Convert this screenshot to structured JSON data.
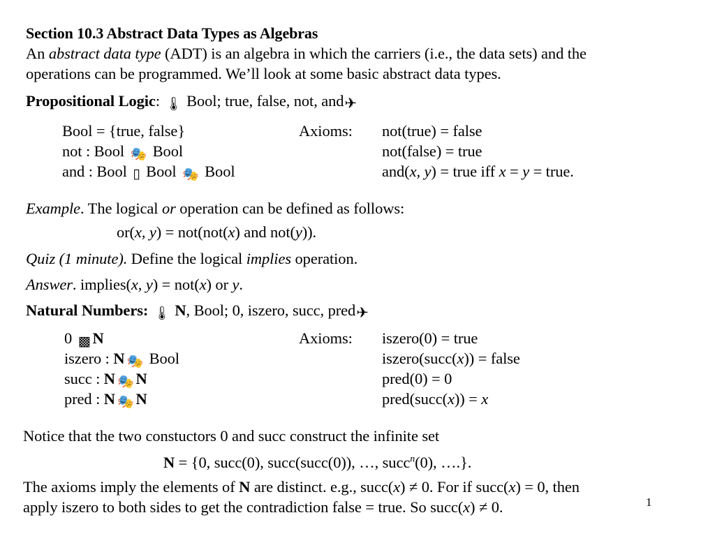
{
  "slide": {
    "page_number": "1",
    "heading": "Section 10.3 Abstract Data Types as Algebras",
    "intro": {
      "line1_a": "An ",
      "line1_i": "abstract data type",
      "line1_b": " (ADT) is an algebra in which the carriers (i.e., the data sets) and the",
      "line2": "operations can be programmed. We’ll look at some basic abstract data types."
    },
    "prop_logic": {
      "label": "Propositional Logic",
      "colon": ":",
      "open_bracket_icon": "thermometer-icon",
      "signature": " Bool; true, false, not, and",
      "close_bracket_icon": "airplane-icon",
      "defs": [
        {
          "text": "Bool = {true, false}"
        },
        {
          "pre": "not : Bool ",
          "icon": "masks-icon",
          "post": " Bool"
        },
        {
          "pre": "and : Bool ",
          "icon": "eraser-icon",
          "mid": " Bool ",
          "icon2": "masks-icon",
          "post": " Bool"
        }
      ],
      "axioms_label": "Axioms:",
      "axioms": [
        {
          "text": "not(true) = false"
        },
        {
          "text": "not(false) = true"
        },
        {
          "pre": "and(",
          "v1": "x, y",
          "post": ") = true iff ",
          "v2": "x",
          "eq": " = ",
          "v3": "y",
          "tail": " = true."
        }
      ]
    },
    "example": {
      "label": "Example",
      "lead": ". The logical ",
      "op": "or",
      "tail": " operation can be defined as follows:",
      "formula_pre": "or(",
      "formula_v": "x, y",
      "formula_mid": ") = not(not(",
      "formula_x": "x",
      "formula_mid2": ") and not(",
      "formula_y": "y",
      "formula_end": "))."
    },
    "quiz": {
      "label": "Quiz (1 minute).",
      "lead": " Define the logical ",
      "op": "implies",
      "tail": " operation."
    },
    "answer": {
      "label": "Answer",
      "lead": ". implies(",
      "v1": "x, y",
      "mid": ") = not(",
      "v2": "x",
      "mid2": ") or ",
      "v3": "y",
      "end": "."
    },
    "naturals": {
      "label": "Natural Numbers:",
      "open_bracket_icon": "thermometer-icon",
      "sig_bold": "N",
      "signature": ", Bool; 0, iszero, succ, pred",
      "close_bracket_icon": "airplane-icon",
      "defs": [
        {
          "pre": "0 ",
          "icon": "element-of-icon",
          "bold": "N"
        },
        {
          "pre": "iszero : ",
          "bold": "N",
          "icon": "masks-icon",
          "post": " Bool"
        },
        {
          "pre": "succ : ",
          "bold": "N",
          "icon": "masks-icon",
          "post_bold": "N"
        },
        {
          "pre": "pred : ",
          "bold": "N",
          "icon": "masks-icon",
          "post_bold": "N"
        }
      ],
      "axioms_label": "Axioms:",
      "axioms": [
        {
          "text": "iszero(0) = true"
        },
        {
          "pre": "iszero(succ(",
          "v": "x",
          "post": ")) = false"
        },
        {
          "text": "pred(0) = 0"
        },
        {
          "pre": "pred(succ(",
          "v": "x",
          "post": ")) = ",
          "v2": "x"
        }
      ]
    },
    "closing": {
      "notice": "Notice that the two constuctors 0 and succ construct the infinite set",
      "set_bold": "N",
      "set_pre": " = {0, succ(0), succ(succ(0)), …, succ",
      "set_sup": "n",
      "set_post": "(0), ….}.",
      "final_a": "The axioms imply the elements of ",
      "final_b": "N",
      "final_c": " are distinct. e.g., succ(",
      "final_x1": "x",
      "final_d": ") ≠ 0. For if succ(",
      "final_x2": "x",
      "final_e": ") = 0, then",
      "final_line2_a": "apply iszero to both sides to get the contradiction false = true. So succ(",
      "final_x3": "x",
      "final_line2_b": ") ≠ 0."
    }
  }
}
